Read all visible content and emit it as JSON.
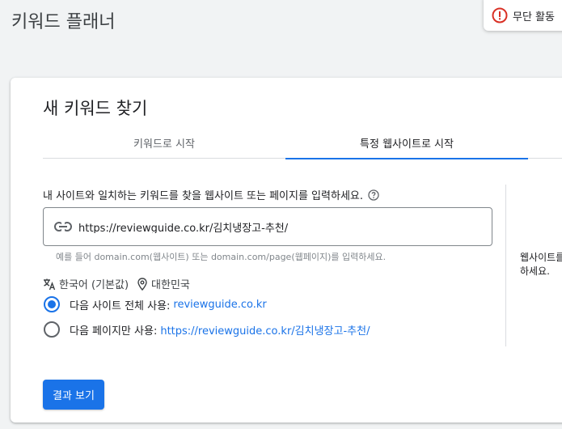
{
  "header": {
    "title": "키워드 플래너"
  },
  "toast": {
    "text": "무단 활동",
    "icon": "error-icon",
    "color": "#d93025"
  },
  "card": {
    "title": "새 키워드 찾기",
    "tabs": [
      {
        "label": "키워드로 시작",
        "active": false
      },
      {
        "label": "특정 웹사이트로 시작",
        "active": true
      }
    ],
    "description": "내 사이트와 일치하는 키워드를 찾을 웹사이트 또는 페이지를 입력하세요.",
    "url_field": {
      "value": "https://reviewguide.co.kr/김치냉장고-추천/",
      "placeholder": ""
    },
    "hint": "예를 들어 domain.com(웹사이트) 또는 domain.com/page(웹페이지)를 입력하세요.",
    "language": "한국어 (기본값)",
    "location": "대한민국",
    "options": [
      {
        "prefix": "다음 사이트 전체 사용: ",
        "link": "reviewguide.co.kr",
        "checked": true
      },
      {
        "prefix": "다음 페이지만 사용: ",
        "link": "https://reviewguide.co.kr/김치냉장고-추천/",
        "checked": false
      }
    ],
    "side_text_1": "웹사이트를",
    "side_text_2": "하세요.",
    "submit_label": "결과 보기"
  },
  "colors": {
    "accent": "#1a73e8",
    "text": "#202124",
    "muted": "#5f6368"
  }
}
